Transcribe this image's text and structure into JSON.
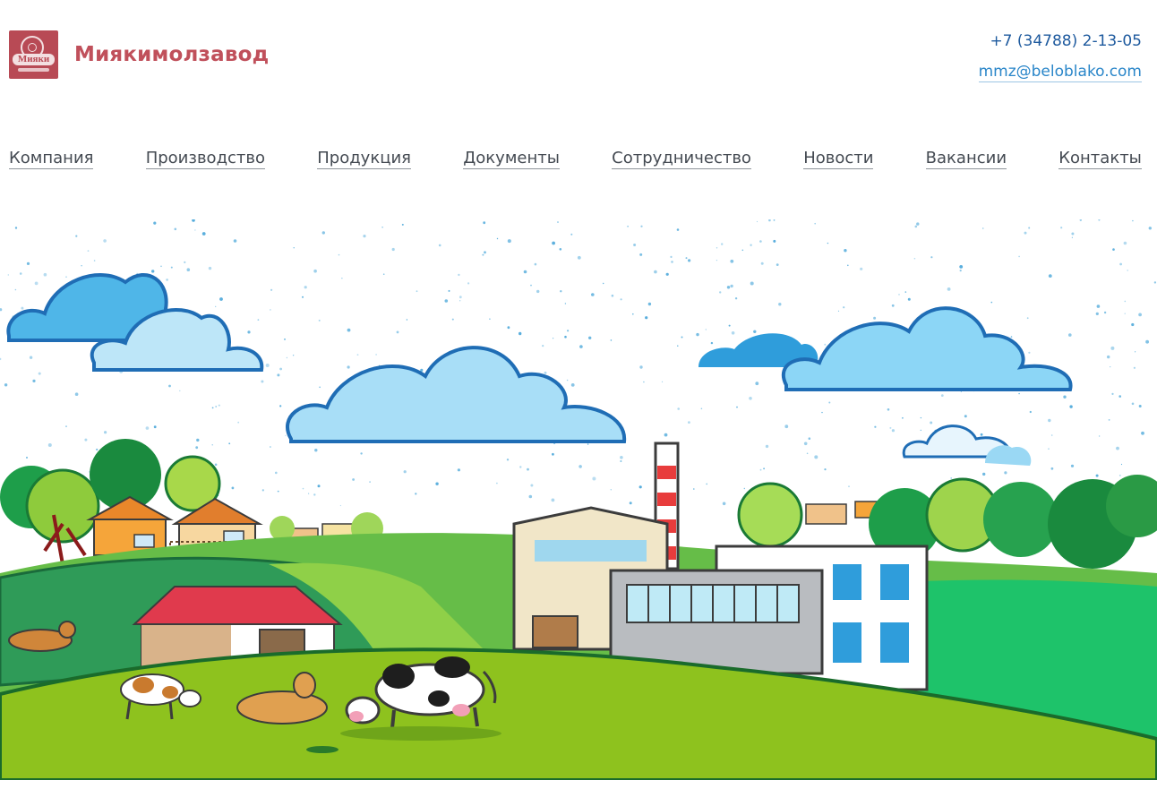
{
  "header": {
    "logo_text": "Мияки",
    "brand_name": "Миякимолзавод",
    "phone": "+7 (34788) 2-13-05",
    "email": "mmz@beloblako.com"
  },
  "nav": {
    "items": [
      {
        "label": "Компания"
      },
      {
        "label": "Производство"
      },
      {
        "label": "Продукция"
      },
      {
        "label": "Документы"
      },
      {
        "label": "Сотрудничество"
      },
      {
        "label": "Новости"
      },
      {
        "label": "Вакансии"
      },
      {
        "label": "Контакты"
      }
    ]
  },
  "colors": {
    "brand": "#c0505b",
    "link": "#2a86c9",
    "phone": "#1e5a9e",
    "nav_text": "#444a52"
  },
  "hero": {
    "illustration": "farm-landscape-with-dairy-factory"
  }
}
